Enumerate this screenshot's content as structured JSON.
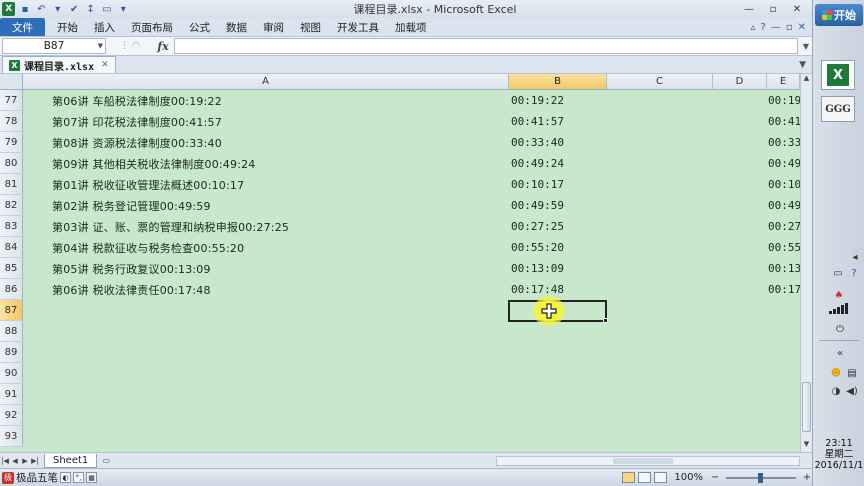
{
  "window": {
    "title": "课程目录.xlsx - Microsoft Excel"
  },
  "ribbon": {
    "tabs": [
      "文件",
      "开始",
      "插入",
      "页面布局",
      "公式",
      "数据",
      "审阅",
      "视图",
      "开发工具",
      "加载项"
    ]
  },
  "formula_bar": {
    "name_box": "B87",
    "fx_label": "fx",
    "formula": ""
  },
  "workbook": {
    "tab_name": "课程目录.xlsx"
  },
  "grid": {
    "columns": [
      "A",
      "B",
      "C",
      "D",
      "E"
    ],
    "rows": [
      {
        "num": "77",
        "a": "第06讲   车船税法律制度00:19:22",
        "b": "00:19:22",
        "e": "00:19"
      },
      {
        "num": "78",
        "a": "第07讲   印花税法律制度00:41:57",
        "b": "00:41:57",
        "e": "00:41"
      },
      {
        "num": "79",
        "a": "第08讲   资源税法律制度00:33:40",
        "b": "00:33:40",
        "e": "00:33"
      },
      {
        "num": "80",
        "a": "第09讲   其他相关税收法律制度00:49:24",
        "b": "00:49:24",
        "e": "00:49"
      },
      {
        "num": "81",
        "a": "第01讲   税收征收管理法概述00:10:17",
        "b": "00:10:17",
        "e": "00:10"
      },
      {
        "num": "82",
        "a": "第02讲   税务登记管理00:49:59",
        "b": "00:49:59",
        "e": "00:49"
      },
      {
        "num": "83",
        "a": "第03讲   证、账、票的管理和纳税申报00:27:25",
        "b": "00:27:25",
        "e": "00:27"
      },
      {
        "num": "84",
        "a": "第04讲   税款征收与税务检查00:55:20",
        "b": "00:55:20",
        "e": "00:55"
      },
      {
        "num": "85",
        "a": "第05讲   税务行政复议00:13:09",
        "b": "00:13:09",
        "e": "00:13"
      },
      {
        "num": "86",
        "a": "第06讲   税收法律责任00:17:48",
        "b": "00:17:48",
        "e": "00:17"
      },
      {
        "num": "87",
        "a": "",
        "b": "",
        "e": ""
      },
      {
        "num": "88",
        "a": "",
        "b": "",
        "e": ""
      },
      {
        "num": "89",
        "a": "",
        "b": "",
        "e": ""
      },
      {
        "num": "90",
        "a": "",
        "b": "",
        "e": ""
      },
      {
        "num": "91",
        "a": "",
        "b": "",
        "e": ""
      },
      {
        "num": "92",
        "a": "",
        "b": "",
        "e": ""
      },
      {
        "num": "93",
        "a": "",
        "b": "",
        "e": ""
      }
    ],
    "selected_column": "B",
    "selected_row": "87"
  },
  "sheets": {
    "active": "Sheet1"
  },
  "status": {
    "zoom": "100%",
    "ime_name": "极品五笔"
  },
  "taskbar": {
    "start_label": "开始",
    "ggg_label": "GGG",
    "clock_time": "23:11",
    "clock_weekday": "星期二",
    "clock_date": "2016/11/1"
  },
  "colors": {
    "grid_background": "#c7e8cc",
    "file_tab": "#2e6db7",
    "selected_header": "#f3c765",
    "cursor_highlight": "#f7f33c"
  }
}
